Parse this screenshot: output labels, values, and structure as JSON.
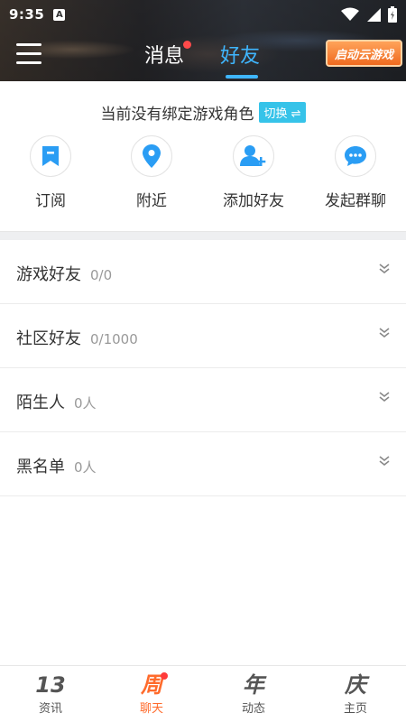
{
  "status_bar": {
    "time": "9:35",
    "notification_letter": "A"
  },
  "header": {
    "tabs": [
      {
        "label": "消息",
        "active": false,
        "has_dot": true
      },
      {
        "label": "好友",
        "active": true,
        "has_dot": false
      }
    ],
    "cloud_game_button": "启动云游戏"
  },
  "role_notice": {
    "text": "当前没有绑定游戏角色",
    "switch_label": "切换 ⇌"
  },
  "quick_actions": [
    {
      "label": "订阅",
      "icon": "bookmark-icon"
    },
    {
      "label": "附近",
      "icon": "location-pin-icon"
    },
    {
      "label": "添加好友",
      "icon": "add-user-icon"
    },
    {
      "label": "发起群聊",
      "icon": "chat-bubble-icon"
    }
  ],
  "friend_groups": [
    {
      "name": "游戏好友",
      "count": "0/0"
    },
    {
      "name": "社区好友",
      "count": "0/1000"
    },
    {
      "name": "陌生人",
      "count": "0人"
    },
    {
      "name": "黑名单",
      "count": "0人"
    }
  ],
  "tab_bar": {
    "items": [
      {
        "glyph": "13",
        "label": "资讯",
        "active": false
      },
      {
        "glyph": "周",
        "label": "聊天",
        "active": true,
        "has_dot": true
      },
      {
        "glyph": "年",
        "label": "动态",
        "active": false
      },
      {
        "glyph": "庆",
        "label": "主页",
        "active": false
      }
    ]
  },
  "colors": {
    "accent_blue": "#3fb6ff",
    "switch_badge": "#36c3e9",
    "active_tab_orange": "#ff6b2c",
    "notification_red": "#ff4a4a"
  }
}
